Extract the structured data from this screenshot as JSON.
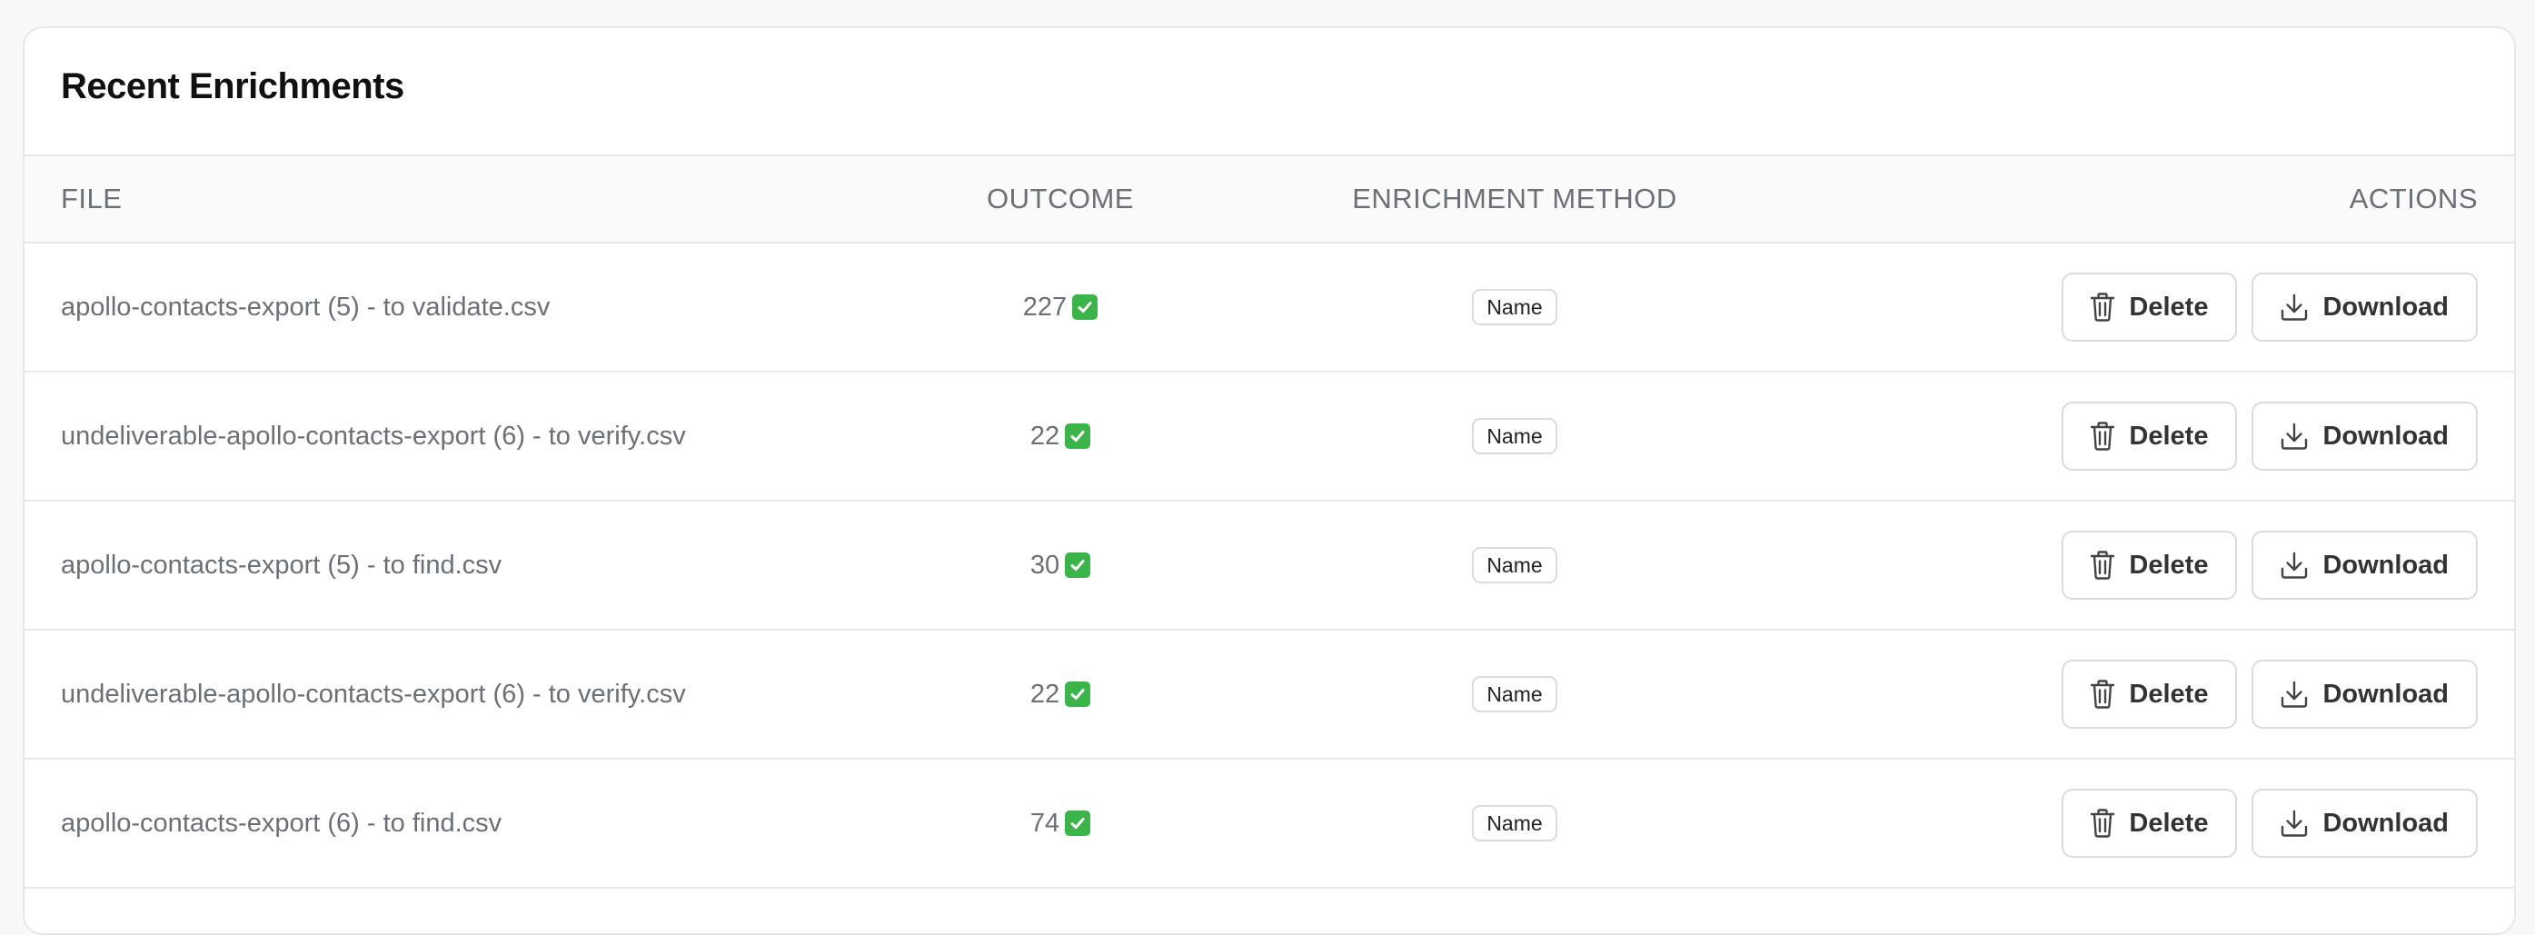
{
  "card": {
    "title": "Recent Enrichments"
  },
  "table": {
    "columns": {
      "file": "FILE",
      "outcome": "OUTCOME",
      "method": "ENRICHMENT METHOD",
      "actions": "ACTIONS"
    },
    "rows": [
      {
        "file": "apollo-contacts-export (5) - to validate.csv",
        "outcome": "227",
        "method": "Name",
        "delete_label": "Delete",
        "download_label": "Download"
      },
      {
        "file": "undeliverable-apollo-contacts-export (6) - to verify.csv",
        "outcome": "22",
        "method": "Name",
        "delete_label": "Delete",
        "download_label": "Download"
      },
      {
        "file": "apollo-contacts-export (5) - to find.csv",
        "outcome": "30",
        "method": "Name",
        "delete_label": "Delete",
        "download_label": "Download"
      },
      {
        "file": "undeliverable-apollo-contacts-export (6) - to verify.csv",
        "outcome": "22",
        "method": "Name",
        "delete_label": "Delete",
        "download_label": "Download"
      },
      {
        "file": "apollo-contacts-export (6) - to find.csv",
        "outcome": "74",
        "method": "Name",
        "delete_label": "Delete",
        "download_label": "Download"
      }
    ]
  },
  "icons": {
    "status": "check-mark-button-icon",
    "delete": "trash-icon",
    "download": "download-icon"
  },
  "colors": {
    "check": "#3bb54a",
    "text_muted": "#6b6f76",
    "border": "#d9dbde"
  }
}
